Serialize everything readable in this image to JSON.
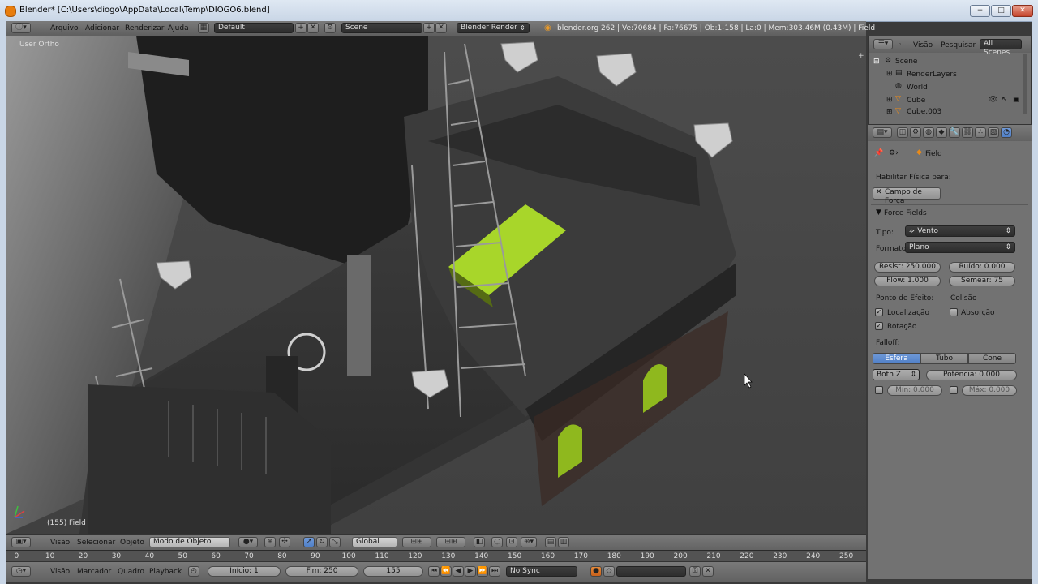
{
  "window": {
    "title": "Blender* [C:\\Users\\diogo\\AppData\\Local\\Temp\\DIOGO6.blend]",
    "min": "−",
    "max": "□",
    "close": "✕"
  },
  "info_header": {
    "menus": [
      "Arquivo",
      "Adicionar",
      "Renderizar",
      "Ajuda"
    ],
    "layout": "Default",
    "scene": "Scene",
    "engine": "Blender Render",
    "stats": "blender.org 262 | Ve:70684 | Fa:76675 | Ob:1-158 | La:0 | Mem:303.46M (0.43M) | Field"
  },
  "viewport": {
    "view_label": "User Ortho",
    "object_label": "(155) Field"
  },
  "view3d_header": {
    "menus": [
      "Visão",
      "Selecionar",
      "Objeto"
    ],
    "mode": "Modo de Objeto",
    "orientation": "Global"
  },
  "ruler": {
    "ticks": [
      "0",
      "10",
      "20",
      "30",
      "40",
      "50",
      "60",
      "70",
      "80",
      "90",
      "100",
      "110",
      "120",
      "130",
      "140",
      "150",
      "160",
      "170",
      "180",
      "190",
      "200",
      "210",
      "220",
      "230",
      "240",
      "250"
    ]
  },
  "timeline_header": {
    "menus": [
      "Visão",
      "Marcador",
      "Quadro",
      "Playback"
    ],
    "start": "Início: 1",
    "end": "Fim: 250",
    "current": "155",
    "sync": "No Sync"
  },
  "outliner": {
    "tabs": [
      "Visão",
      "Pesquisar",
      "All Scenes"
    ],
    "items": [
      {
        "label": "Scene"
      },
      {
        "label": "RenderLayers"
      },
      {
        "label": "World"
      },
      {
        "label": "Cube"
      },
      {
        "label": "Cube.003"
      }
    ]
  },
  "properties": {
    "breadcrumb": "Field",
    "physics_label": "Habilitar Física para:",
    "force_field_button": "Campo de Força",
    "panel_title": "Force Fields",
    "tipo_label": "Tipo:",
    "tipo_value": "Vento",
    "formato_label": "Formato:",
    "formato_value": "Plano",
    "resist": "Resist: 250.000",
    "ruido": "Ruído: 0.000",
    "flow": "Flow: 1.000",
    "semear": "Semear: 75",
    "ponto_label": "Ponto de Efeito:",
    "colisao_label": "Colisão",
    "localizacao": "Localização",
    "absorcao": "Absorção",
    "rotacao": "Rotação",
    "falloff_label": "Falloff:",
    "falloff_options": [
      "Esfera",
      "Tubo",
      "Cone"
    ],
    "falloff_selected": "Esfera",
    "axis": "Both Z",
    "potencia": "Potência: 0.000",
    "min": "Mín: 0.000",
    "max": "Máx: 0.000"
  },
  "colors": {
    "accent_blue": "#5080c8",
    "lime": "#a8d62a",
    "viewport_bg": "#454545"
  }
}
